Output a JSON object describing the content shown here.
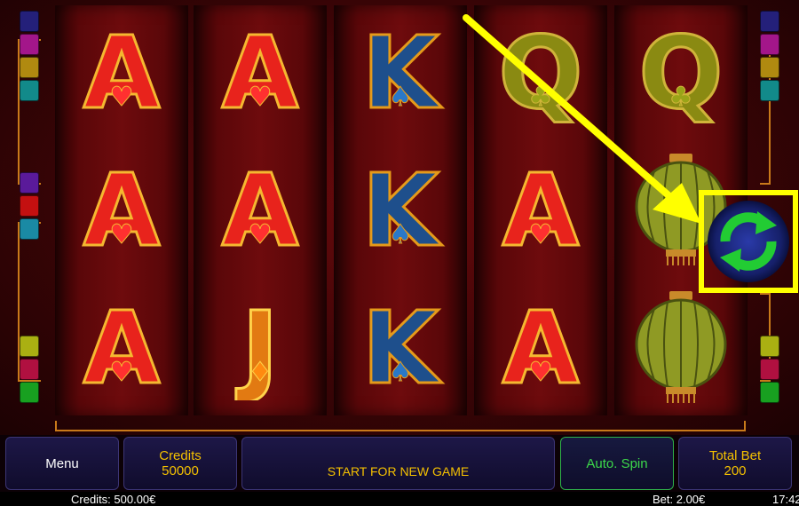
{
  "reels": [
    [
      "A",
      "A",
      "A"
    ],
    [
      "A",
      "A",
      "J"
    ],
    [
      "K",
      "K",
      "K"
    ],
    [
      "Q",
      "A",
      "A"
    ],
    [
      "Q",
      "lantern",
      "lantern"
    ]
  ],
  "controls": {
    "menu_label": "Menu",
    "credits_label": "Credits",
    "credits_value": "50000",
    "start_label": "START FOR NEW GAME",
    "autospin_label": "Auto. Spin",
    "totalbet_label": "Total Bet",
    "totalbet_value": "200"
  },
  "status": {
    "credits": "Credits: 500.00€",
    "bet": "Bet: 2.00€",
    "time": "17:42"
  },
  "annotation": {
    "color": "#ffff00",
    "icon": "refresh-icon"
  },
  "colors": {
    "ace_red": "#e8231c",
    "king_blue": "#1e4f8c",
    "queen_olive": "#8a8a12",
    "jack_orange": "#e27a12",
    "gold": "#f4c000",
    "spin_green": "#22cc33"
  }
}
